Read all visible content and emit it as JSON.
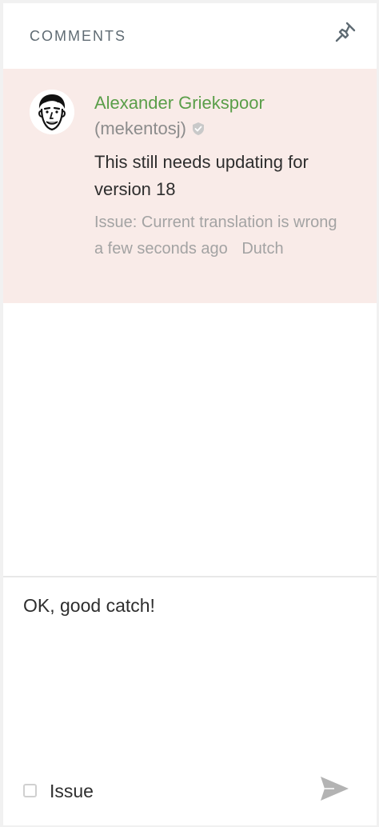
{
  "header": {
    "title": "COMMENTS",
    "pin_icon": "pin-icon"
  },
  "comment": {
    "author": "Alexander Griekspoor",
    "handle": "(mekentosj)",
    "verified_icon": "shield-check-icon",
    "text": "This still needs updating for version 18",
    "issue": "Issue: Current translation is wrong",
    "time": "a few seconds ago",
    "language": "Dutch"
  },
  "reply": {
    "value": "OK, good catch!",
    "issue_label": "Issue",
    "issue_checked": false,
    "send_icon": "send-icon"
  },
  "colors": {
    "author": "#5a9e49",
    "card_bg": "#f9ebe8",
    "muted": "#a3a3a3"
  }
}
